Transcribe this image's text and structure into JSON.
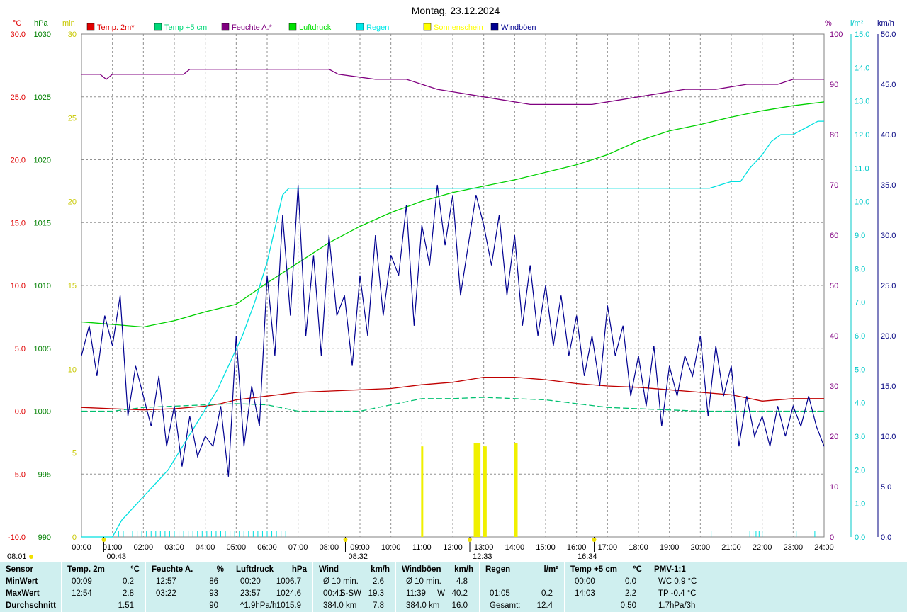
{
  "title": "Montag, 23.12.2024",
  "legend": [
    {
      "label": "Temp. 2m*",
      "color": "#e00000"
    },
    {
      "label": "Temp +5 cm",
      "color": "#00d878"
    },
    {
      "label": "Feuchte A.*",
      "color": "#800080"
    },
    {
      "label": "Luftdruck",
      "color": "#00e000"
    },
    {
      "label": "Regen",
      "color": "#00e8e8"
    },
    {
      "label": "Sonnenschein",
      "color": "#ffff00"
    },
    {
      "label": "Windböen",
      "color": "#000090"
    }
  ],
  "axes": {
    "temp": {
      "unit": "°C",
      "min": -10,
      "max": 30,
      "step": 5,
      "color": "#e00000"
    },
    "pressure": {
      "unit": "hPa",
      "min": 990,
      "max": 1030,
      "step": 5,
      "color": "#008000"
    },
    "sun": {
      "unit": "min",
      "min": 0,
      "max": 30,
      "step": 5,
      "color": "#c8c800"
    },
    "humidity": {
      "unit": "%",
      "min": 0,
      "max": 100,
      "step": 10,
      "color": "#800080"
    },
    "rain": {
      "unit": "l/m²",
      "min": 0,
      "max": 15,
      "step": 1,
      "color": "#00c8c8"
    },
    "wind": {
      "unit": "km/h",
      "min": 0,
      "max": 50,
      "step": 5,
      "color": "#000080"
    }
  },
  "x_ticks": [
    "00:00",
    "01:00",
    "02:00",
    "03:00",
    "04:00",
    "05:00",
    "06:00",
    "07:00",
    "08:00",
    "09:00",
    "10:00",
    "11:00",
    "12:00",
    "13:00",
    "14:00",
    "15:00",
    "16:00",
    "17:00",
    "18:00",
    "19:00",
    "20:00",
    "21:00",
    "22:00",
    "23:00",
    "24:00"
  ],
  "time_markers": [
    {
      "label": "08:01",
      "hour": 0.0,
      "kind": "sunrise",
      "color": "#000000"
    },
    {
      "label": "00:43",
      "hour": 0.72,
      "kind": "moon",
      "color": "#000000"
    },
    {
      "label": "08:32",
      "hour": 8.53,
      "kind": "sun",
      "color": "#000000"
    },
    {
      "label": "12:33",
      "hour": 12.55,
      "kind": "moon",
      "color": "#000000"
    },
    {
      "label": "16:34",
      "hour": 16.57,
      "kind": "sunset",
      "color": "#000000"
    }
  ],
  "chart_data": {
    "type": "line",
    "x_unit": "hour",
    "x_range": [
      0,
      24
    ],
    "series": [
      {
        "name": "Temp. 2m*",
        "axis": "temp",
        "color": "#c00000",
        "x": [
          0,
          1,
          2,
          3,
          4,
          4.5,
          5,
          6,
          7,
          8,
          9,
          10,
          11,
          12,
          12.5,
          13,
          14,
          15,
          16,
          17,
          18,
          19,
          20,
          21,
          22,
          23,
          24
        ],
        "y": [
          0.3,
          0.2,
          0.1,
          0.2,
          0.4,
          0.6,
          0.9,
          1.2,
          1.5,
          1.6,
          1.7,
          1.8,
          2.1,
          2.3,
          2.5,
          2.7,
          2.7,
          2.5,
          2.2,
          2.0,
          1.9,
          1.7,
          1.5,
          1.3,
          0.8,
          1.0,
          1.0
        ]
      },
      {
        "name": "Temp +5 cm",
        "axis": "temp",
        "color": "#00c070",
        "x": [
          0,
          1,
          2,
          3,
          4,
          5,
          6,
          7,
          8,
          9,
          10,
          11,
          12,
          13,
          14,
          15,
          16,
          17,
          18,
          19,
          20,
          21,
          22,
          23,
          24
        ],
        "y": [
          0.0,
          0.0,
          0.3,
          0.4,
          0.5,
          0.6,
          0.5,
          0.0,
          0.0,
          0.0,
          0.5,
          1.0,
          1.0,
          1.1,
          1.0,
          0.9,
          0.6,
          0.3,
          0.2,
          0.1,
          0.0,
          0.0,
          0.0,
          0.0,
          0.0
        ]
      },
      {
        "name": "Feuchte A.*",
        "axis": "humidity",
        "color": "#800080",
        "x": [
          0,
          0.6,
          0.8,
          1.0,
          3.3,
          3.5,
          4.0,
          8.0,
          8.3,
          9.5,
          10.5,
          11.5,
          12.5,
          13.5,
          14.5,
          15.5,
          16.5,
          17.5,
          18.5,
          19.5,
          20.5,
          21.5,
          22.5,
          23.0,
          24
        ],
        "y": [
          92,
          92,
          91,
          92,
          92,
          93,
          93,
          93,
          92,
          91,
          91,
          89,
          88,
          87,
          86,
          86,
          86,
          87,
          88,
          89,
          89,
          90,
          90,
          91,
          91
        ]
      },
      {
        "name": "Luftdruck",
        "axis": "pressure",
        "color": "#00d000",
        "x": [
          0,
          1,
          2,
          3,
          4,
          5,
          6,
          7,
          8,
          9,
          10,
          11,
          12,
          13,
          14,
          15,
          16,
          17,
          18,
          19,
          20,
          21,
          22,
          23,
          24
        ],
        "y": [
          1007.1,
          1006.9,
          1006.7,
          1007.2,
          1007.9,
          1008.5,
          1010.2,
          1011.8,
          1013.4,
          1014.7,
          1015.8,
          1016.7,
          1017.4,
          1017.9,
          1018.4,
          1019.0,
          1019.6,
          1020.4,
          1021.5,
          1022.3,
          1022.8,
          1023.4,
          1023.9,
          1024.3,
          1024.6
        ]
      },
      {
        "name": "Regen",
        "axis": "rain",
        "color": "#00e0e0",
        "x": [
          0,
          1.0,
          1.3,
          1.6,
          2.0,
          2.4,
          2.8,
          3.2,
          3.6,
          4.0,
          4.4,
          4.8,
          5.2,
          5.6,
          6.0,
          6.3,
          6.5,
          6.7,
          20.0,
          20.3,
          21.0,
          21.3,
          21.6,
          22.0,
          22.3,
          22.6,
          23.0,
          23.4,
          23.8,
          24
        ],
        "y": [
          0,
          0,
          0.5,
          0.8,
          1.2,
          1.6,
          2.0,
          2.6,
          3.2,
          3.8,
          4.4,
          5.2,
          6.0,
          7.0,
          8.2,
          9.4,
          10.2,
          10.4,
          10.4,
          10.4,
          10.6,
          10.6,
          11.0,
          11.4,
          11.8,
          12.0,
          12.0,
          12.2,
          12.4,
          12.4
        ]
      },
      {
        "name": "Windböen",
        "axis": "wind",
        "color": "#000090",
        "x": [
          0,
          0.25,
          0.5,
          0.75,
          1,
          1.25,
          1.5,
          1.75,
          2,
          2.25,
          2.5,
          2.75,
          3,
          3.25,
          3.5,
          3.75,
          4,
          4.25,
          4.5,
          4.75,
          5,
          5.25,
          5.5,
          5.75,
          6,
          6.25,
          6.5,
          6.75,
          7,
          7.25,
          7.5,
          7.75,
          8,
          8.25,
          8.5,
          8.75,
          9,
          9.25,
          9.5,
          9.75,
          10,
          10.25,
          10.5,
          10.75,
          11,
          11.25,
          11.5,
          11.75,
          12,
          12.25,
          12.5,
          12.75,
          13,
          13.25,
          13.5,
          13.75,
          14,
          14.25,
          14.5,
          14.75,
          15,
          15.25,
          15.5,
          15.75,
          16,
          16.25,
          16.5,
          16.75,
          17,
          17.25,
          17.5,
          17.75,
          18,
          18.25,
          18.5,
          18.75,
          19,
          19.25,
          19.5,
          19.75,
          20,
          20.25,
          20.5,
          20.75,
          21,
          21.25,
          21.5,
          21.75,
          22,
          22.25,
          22.5,
          22.75,
          23,
          23.25,
          23.5,
          23.75,
          24
        ],
        "y": [
          18,
          21,
          16,
          22,
          19,
          24,
          12,
          17,
          14,
          11,
          16,
          9,
          13,
          7,
          12,
          8,
          10,
          9,
          13,
          6,
          20,
          9,
          15,
          11,
          26,
          18,
          32,
          22,
          35,
          20,
          28,
          18,
          30,
          22,
          24,
          17,
          26,
          20,
          30,
          22,
          28,
          26,
          33,
          21,
          31,
          27,
          35,
          29,
          34,
          24,
          29,
          34,
          31,
          27,
          32,
          24,
          30,
          21,
          27,
          20,
          25,
          19,
          24,
          18,
          22,
          16,
          20,
          15,
          23,
          18,
          21,
          14,
          18,
          13,
          19,
          11,
          17,
          14,
          18,
          16,
          20,
          12,
          19,
          14,
          17,
          9,
          14,
          10,
          12,
          9,
          13,
          10,
          13,
          11,
          14,
          11,
          9
        ]
      }
    ],
    "sunshine": {
      "axis": "sun",
      "color": "#f0f000",
      "x": [
        11.0,
        12.7,
        12.75,
        12.8,
        12.85,
        13.0,
        13.05,
        14.0,
        14.05
      ],
      "y": [
        5.4,
        5.6,
        5.6,
        5.6,
        5.6,
        5.4,
        5.4,
        5.6,
        5.6
      ]
    }
  },
  "table": {
    "sensor": {
      "header": "Sensor",
      "rows": [
        "MinWert",
        "MaxWert",
        "Durchschnitt"
      ]
    },
    "columns": [
      {
        "header": "Temp. 2m",
        "unit": "°C",
        "rows": [
          [
            "00:09",
            "",
            "0.2"
          ],
          [
            "12:54",
            "",
            "2.8"
          ],
          [
            "",
            "",
            "1.51"
          ]
        ]
      },
      {
        "header": "Feuchte A.",
        "unit": "%",
        "rows": [
          [
            "12:57",
            "",
            "86"
          ],
          [
            "03:22",
            "",
            "93"
          ],
          [
            "",
            "",
            "90"
          ]
        ]
      },
      {
        "header": "Luftdruck",
        "unit": "hPa",
        "rows": [
          [
            "00:20",
            "",
            "1006.7"
          ],
          [
            "23:57",
            "",
            "1024.6"
          ],
          [
            "^1.9hPa/h",
            "",
            "1015.9"
          ]
        ]
      },
      {
        "header": "Wind",
        "unit": "km/h",
        "rows": [
          [
            "Ø 10 min.",
            "",
            "2.6"
          ],
          [
            "00:41",
            "S-SW",
            "19.3"
          ],
          [
            "384.0 km",
            "",
            "7.8"
          ]
        ]
      },
      {
        "header": "Windböen",
        "unit": "km/h",
        "rows": [
          [
            "Ø 10 min.",
            "",
            "4.8"
          ],
          [
            "11:39",
            "W",
            "40.2"
          ],
          [
            "384.0 km",
            "",
            "16.0"
          ]
        ]
      },
      {
        "header": "Regen",
        "unit": "l/m²",
        "rows": [
          [
            "",
            "",
            ""
          ],
          [
            "01:05",
            "",
            "0.2"
          ],
          [
            "Gesamt:",
            "",
            "12.4"
          ]
        ]
      },
      {
        "header": "Temp +5 cm",
        "unit": "°C",
        "rows": [
          [
            "00:00",
            "",
            "0.0"
          ],
          [
            "14:03",
            "",
            "2.2"
          ],
          [
            "",
            "",
            "0.50"
          ]
        ]
      },
      {
        "header": "PMV-1:1",
        "unit": "",
        "rows": [
          [
            "WC 0.9 °C",
            "",
            ""
          ],
          [
            "TP -0.4 °C",
            "",
            ""
          ],
          [
            "1.7hPa/3h",
            "",
            ""
          ]
        ]
      }
    ]
  }
}
